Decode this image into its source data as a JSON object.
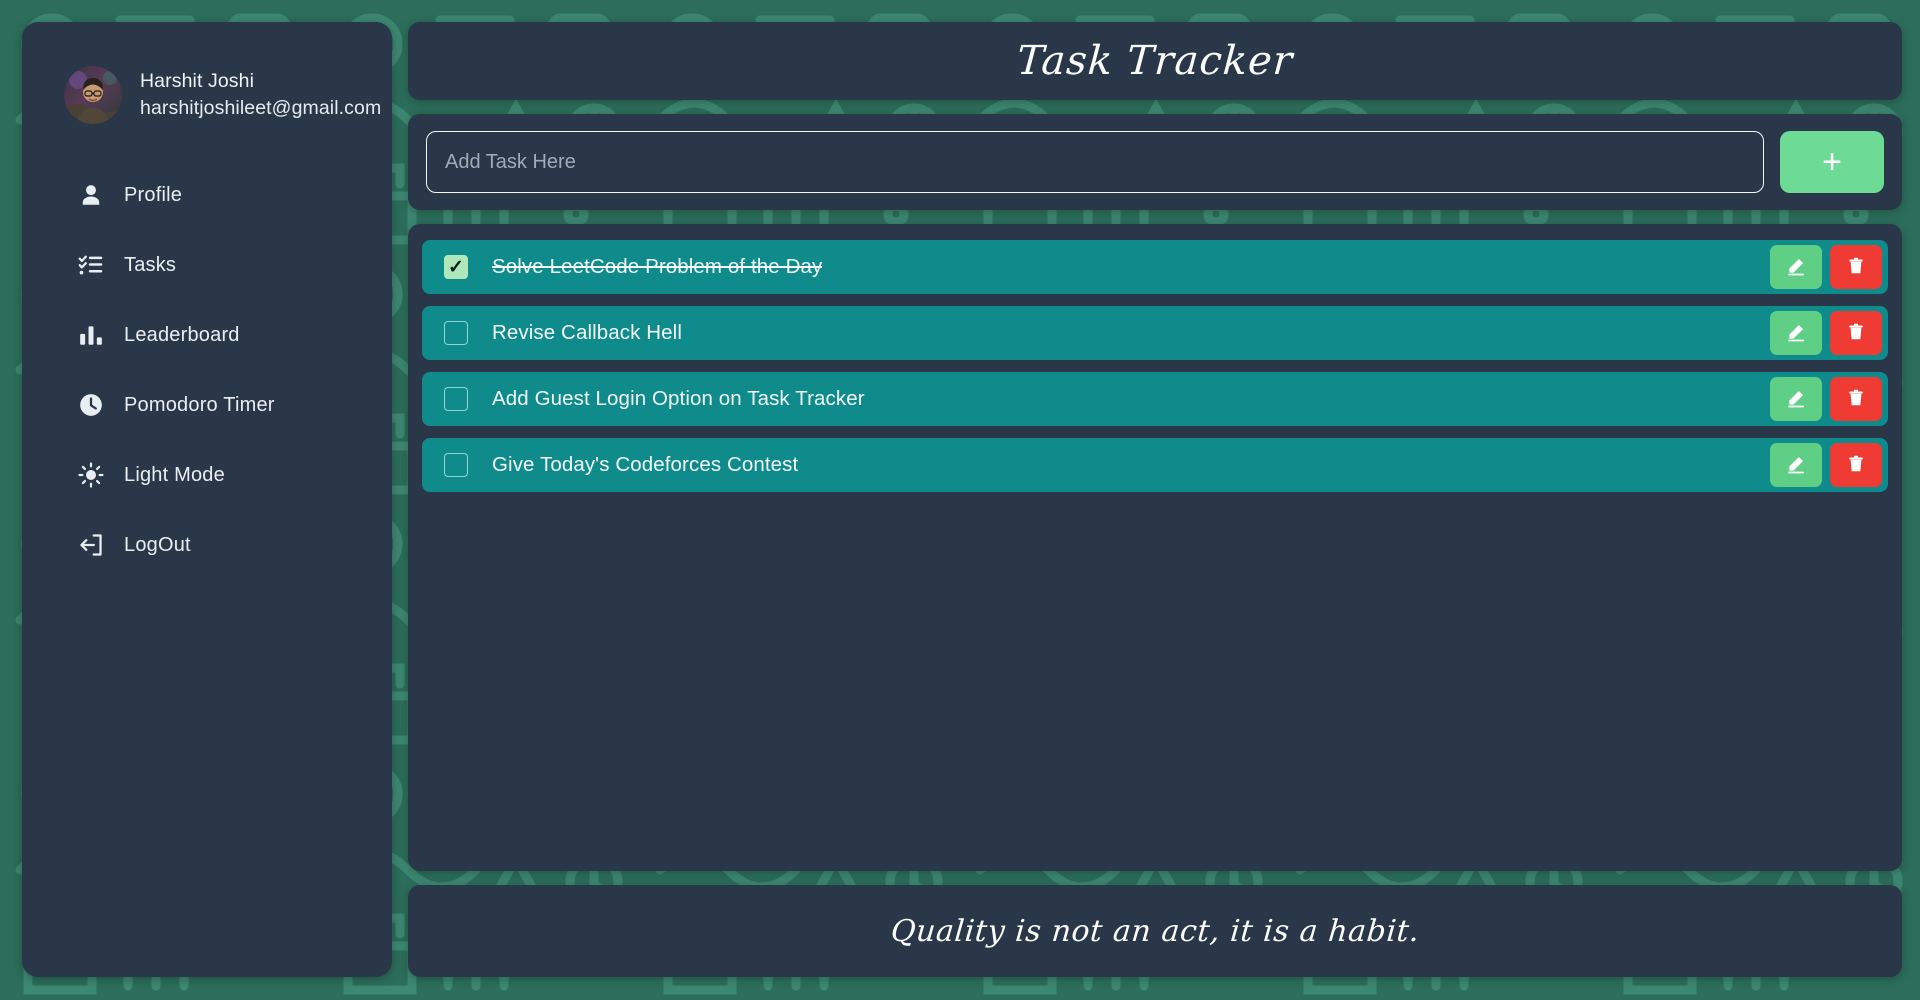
{
  "background": {
    "base_color": "#2c6e5b",
    "doodle_color": "#3d8872",
    "pattern_name": "green-doodle-pattern"
  },
  "theme": {
    "panel_color": "#2a3748",
    "task_row_color": "#108b8b",
    "accent_green": "#6ddb95",
    "edit_green": "#5fcf86",
    "delete_red": "#ef3b33",
    "checkbox_checked_color": "#aee8ba",
    "text_color": "#f2f7f9"
  },
  "sidebar": {
    "profile": {
      "avatar_name": "user-avatar-photo",
      "name": "Harshit Joshi",
      "email": "harshitjoshileet@gmail.com"
    },
    "items": [
      {
        "label": "Profile",
        "icon": "user-icon"
      },
      {
        "label": "Tasks",
        "icon": "checklist-icon"
      },
      {
        "label": "Leaderboard",
        "icon": "bar-chart-icon"
      },
      {
        "label": "Pomodoro Timer",
        "icon": "clock-icon"
      },
      {
        "label": "Light Mode",
        "icon": "sun-icon"
      },
      {
        "label": "LogOut",
        "icon": "logout-icon"
      }
    ]
  },
  "header": {
    "title": "Task Tracker"
  },
  "add_bar": {
    "placeholder": "Add Task Here",
    "value": "",
    "add_label": "+",
    "add_icon": "plus-icon"
  },
  "tasks": [
    {
      "text": "Solve LeetCode Problem of the Day",
      "completed": true,
      "edit_icon": "pencil-icon",
      "delete_icon": "trash-icon"
    },
    {
      "text": "Revise Callback Hell",
      "completed": false,
      "edit_icon": "pencil-icon",
      "delete_icon": "trash-icon"
    },
    {
      "text": "Add Guest Login Option on Task Tracker",
      "completed": false,
      "edit_icon": "pencil-icon",
      "delete_icon": "trash-icon"
    },
    {
      "text": "Give Today's Codeforces Contest",
      "completed": false,
      "edit_icon": "pencil-icon",
      "delete_icon": "trash-icon"
    }
  ],
  "footer": {
    "quote": "Quality is not an act, it is a habit."
  }
}
